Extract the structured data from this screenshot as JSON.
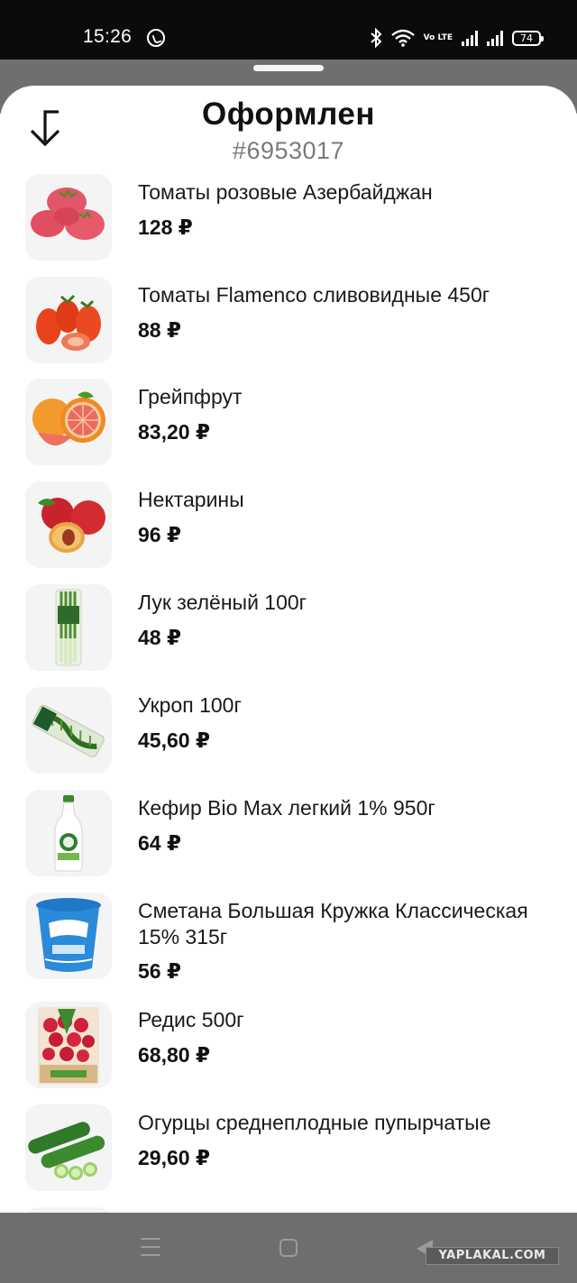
{
  "status_bar": {
    "time": "15:26",
    "network_label": "Vo LTE",
    "battery": "74"
  },
  "header": {
    "title": "Оформлен",
    "order_number": "#6953017",
    "back_icon": "back-arrow-icon"
  },
  "items": [
    {
      "name": "Томаты розовые Азербайджан",
      "price": "128 ₽",
      "thumb": "pink-tomatoes"
    },
    {
      "name": "Томаты Flamenco сливовидные 450г",
      "price": "88 ₽",
      "thumb": "plum-tomatoes"
    },
    {
      "name": "Грейпфрут",
      "price": "83,20 ₽",
      "thumb": "grapefruit"
    },
    {
      "name": "Нектарины",
      "price": "96 ₽",
      "thumb": "nectarines"
    },
    {
      "name": "Лук зелёный 100г",
      "price": "48 ₽",
      "thumb": "green-onion"
    },
    {
      "name": "Укроп 100г",
      "price": "45,60 ₽",
      "thumb": "dill"
    },
    {
      "name": "Кефир Bio Max легкий 1% 950г",
      "price": "64 ₽",
      "thumb": "kefir-bottle"
    },
    {
      "name": "Сметана Большая Кружка Классическая 15% 315г",
      "price": "56 ₽",
      "thumb": "sour-cream-cup"
    },
    {
      "name": "Редис 500г",
      "price": "68,80 ₽",
      "thumb": "radish-pack"
    },
    {
      "name": "Огурцы среднеплодные пупырчатые",
      "price": "29,60 ₽",
      "thumb": "cucumbers"
    }
  ],
  "nav_bar": {
    "watermark": "YAPLAKAL.COM"
  }
}
